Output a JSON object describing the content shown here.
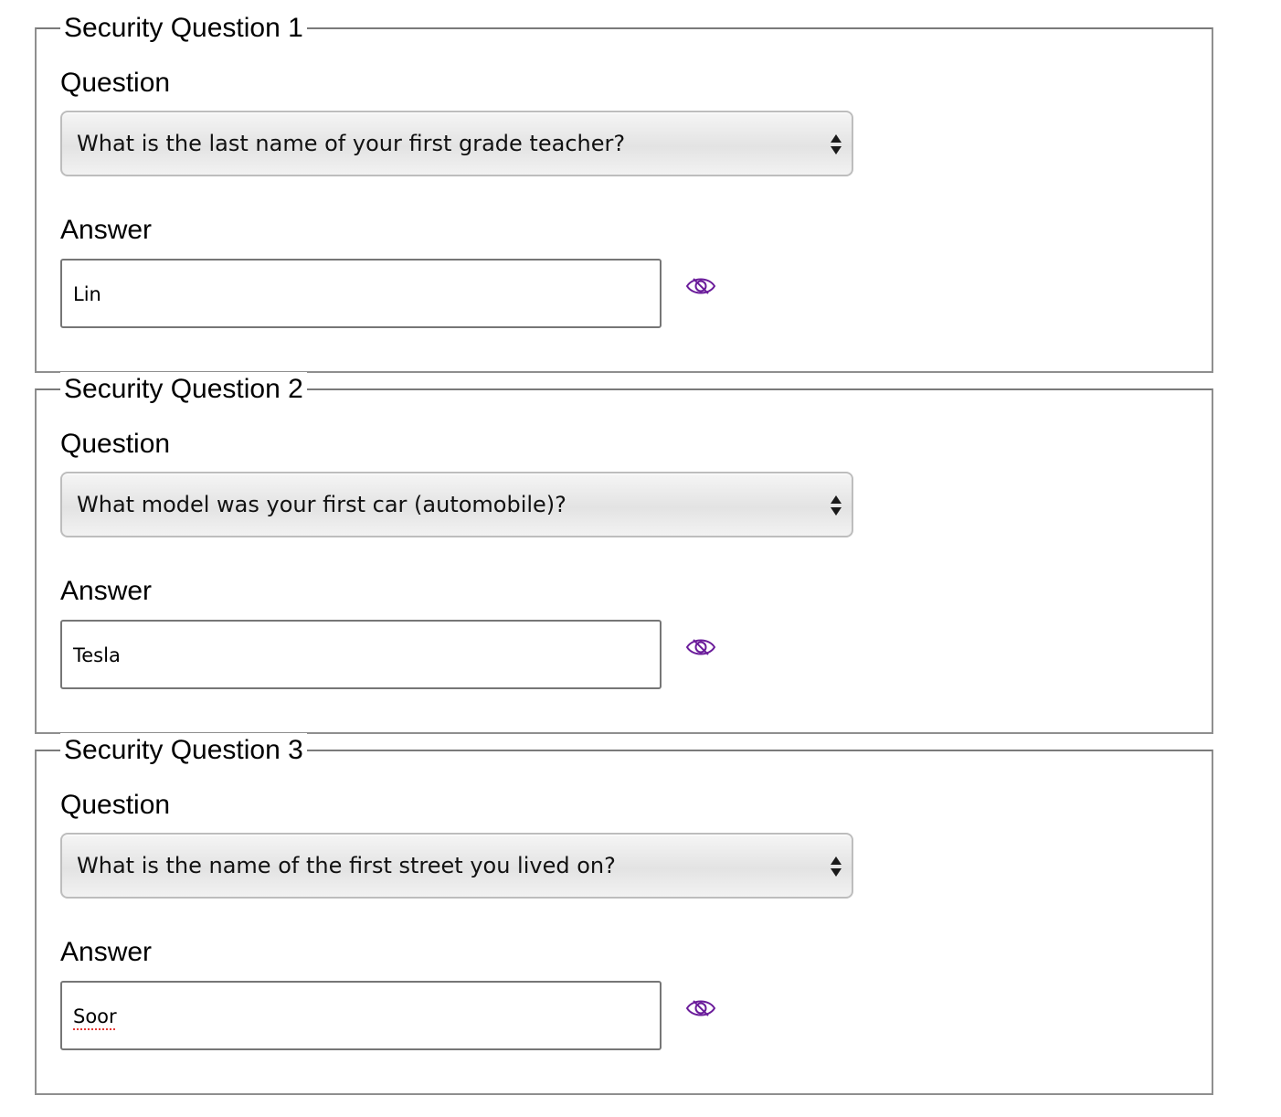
{
  "colors": {
    "eye_icon": "#6a1b9a",
    "fieldset_border": "#8f8f8f",
    "select_border": "#bdbdbd",
    "input_border": "#767676"
  },
  "icons": {
    "select_arrows": "up-down-arrows-icon",
    "reveal": "eye-icon"
  },
  "security_questions": [
    {
      "legend": "Security Question 1",
      "question_label": "Question",
      "question_value": "What is the last name of your first grade teacher?",
      "answer_label": "Answer",
      "answer_value": "Lin"
    },
    {
      "legend": "Security Question 2",
      "question_label": "Question",
      "question_value": "What model was your first car (automobile)?",
      "answer_label": "Answer",
      "answer_value": "Tesla"
    },
    {
      "legend": "Security Question 3",
      "question_label": "Question",
      "question_value": "What is the name of the first street you lived on?",
      "answer_label": "Answer",
      "answer_value": "Soor"
    }
  ]
}
